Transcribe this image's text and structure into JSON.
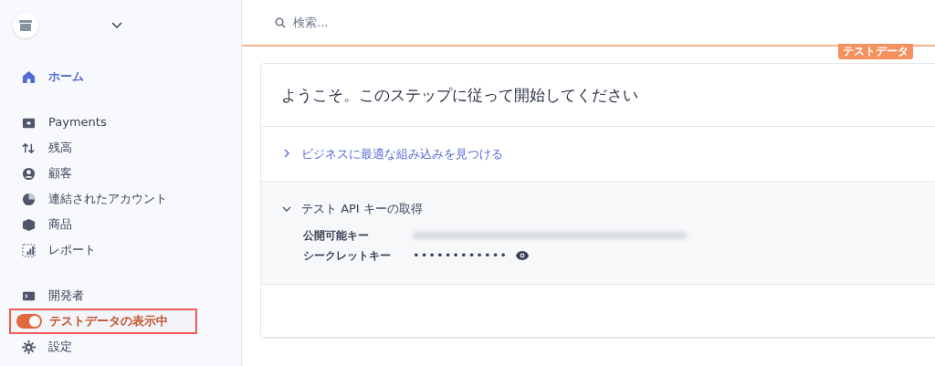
{
  "sidebar": {
    "account_menu": {
      "expanded": false
    },
    "groups": [
      [
        {
          "kind": "link",
          "label": "ホーム",
          "selected": true
        }
      ],
      [
        {
          "kind": "link",
          "label": "Payments",
          "selected": false
        },
        {
          "kind": "link",
          "label": "残高",
          "selected": false
        },
        {
          "kind": "link",
          "label": "顧客",
          "selected": false
        },
        {
          "kind": "link",
          "label": "連結されたアカウント",
          "selected": false
        },
        {
          "kind": "link",
          "label": "商品",
          "selected": false
        },
        {
          "kind": "link",
          "label": "レポート",
          "selected": false
        }
      ],
      [
        {
          "kind": "link",
          "label": "開発者",
          "selected": false
        },
        {
          "kind": "toggle",
          "label": "テストデータの表示中",
          "on": true,
          "highlighted": true
        },
        {
          "kind": "link",
          "label": "設定",
          "selected": false
        }
      ]
    ]
  },
  "search": {
    "placeholder": "検索..."
  },
  "test_badge": "テストデータ",
  "card": {
    "title": "ようこそ。このステップに従って開始してください",
    "sections": [
      {
        "title": "ビジネスに最適な組み込みを見つける",
        "expanded": false
      },
      {
        "title": "テスト API キーの取得",
        "expanded": true,
        "fields": [
          {
            "label": "公開可能キー",
            "kind": "blurred"
          },
          {
            "label": "シークレットキー",
            "kind": "secret",
            "value": "••••••••••••"
          }
        ]
      }
    ]
  }
}
